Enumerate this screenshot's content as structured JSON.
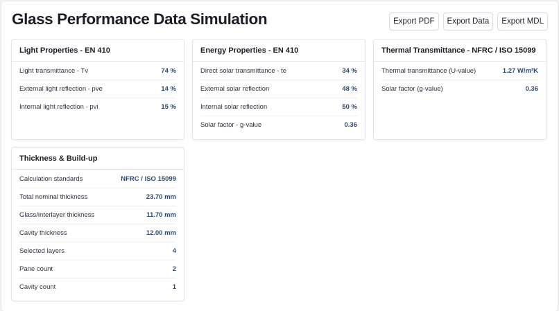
{
  "header": {
    "title": "Glass Performance Data Simulation",
    "buttons": {
      "export_pdf": "Export PDF",
      "export_data": "Export Data",
      "export_mdl": "Export MDL"
    }
  },
  "cards": {
    "light": {
      "title": "Light Properties - EN 410",
      "rows": [
        {
          "label": "Light transmittance - Tv",
          "value": "74 %"
        },
        {
          "label": "External light reflection - pve",
          "value": "14 %"
        },
        {
          "label": "Internal light reflection - pvi",
          "value": "15 %"
        }
      ]
    },
    "energy": {
      "title": "Energy Properties - EN 410",
      "rows": [
        {
          "label": "Direct solar transmittance - te",
          "value": "34 %"
        },
        {
          "label": "External solar reflection",
          "value": "48 %"
        },
        {
          "label": "Internal solar reflection",
          "value": "50 %"
        },
        {
          "label": "Solar factor - g-value",
          "value": "0.36"
        }
      ]
    },
    "thermal": {
      "title": "Thermal Transmittance - NFRC / ISO 15099",
      "rows": [
        {
          "label": "Thermal transmittance (U-value)",
          "value": "1.27 W/m²K"
        },
        {
          "label": "Solar factor (g-value)",
          "value": "0.36"
        }
      ]
    },
    "thickness": {
      "title": "Thickness & Build-up",
      "rows": [
        {
          "label": "Calculation standards",
          "value": "NFRC / ISO 15099"
        },
        {
          "label": "Total nominal thickness",
          "value": "23.70 mm"
        },
        {
          "label": "Glass/interlayer thickness",
          "value": "11.70 mm"
        },
        {
          "label": "Cavity thickness",
          "value": "12.00 mm"
        },
        {
          "label": "Selected layers",
          "value": "4"
        },
        {
          "label": "Pane count",
          "value": "2"
        },
        {
          "label": "Cavity count",
          "value": "1"
        }
      ]
    }
  },
  "colors": {
    "value_text": "#2d4a73",
    "card_border": "#e2e4e9",
    "page_background": "#f1f2f4"
  }
}
